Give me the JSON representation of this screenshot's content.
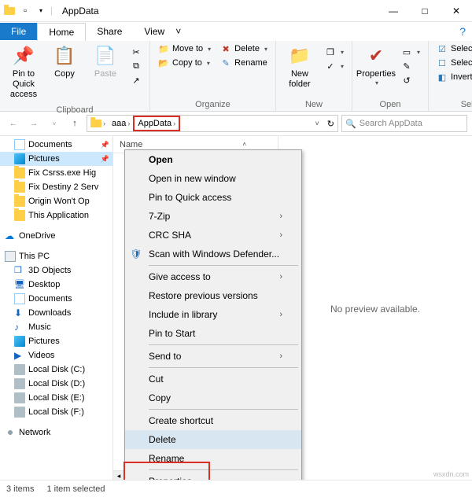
{
  "titlebar": {
    "title": "AppData"
  },
  "window": {
    "minimize": "—",
    "maximize": "□",
    "close": "✕"
  },
  "tabs": {
    "file": "File",
    "home": "Home",
    "share": "Share",
    "view": "View"
  },
  "ribbon": {
    "clipboard": {
      "pin": "Pin to Quick access",
      "copy": "Copy",
      "paste": "Paste",
      "label": "Clipboard"
    },
    "organize": {
      "moveto": "Move to",
      "copyto": "Copy to",
      "delete": "Delete",
      "rename": "Rename",
      "label": "Organize"
    },
    "new": {
      "newfolder": "New folder",
      "label": "New"
    },
    "open": {
      "properties": "Properties",
      "label": "Open"
    },
    "select": {
      "selectall": "Select all",
      "selectnone": "Select none",
      "invert": "Invert selection",
      "label": "Select"
    }
  },
  "address": {
    "seg1": "aaa",
    "seg2": "AppData",
    "refresh": "↻"
  },
  "search": {
    "placeholder": "Search AppData"
  },
  "nav": {
    "documents": "Documents",
    "pictures": "Pictures",
    "fix_csrss": "Fix Csrss.exe Hig",
    "fix_destiny": "Fix Destiny 2 Serv",
    "origin": "Origin Won't Op",
    "thisapp": "This Application",
    "onedrive": "OneDrive",
    "thispc": "This PC",
    "objects3d": "3D Objects",
    "desktop": "Desktop",
    "documents2": "Documents",
    "downloads": "Downloads",
    "music": "Music",
    "pictures2": "Pictures",
    "videos": "Videos",
    "cdrive": "Local Disk (C:)",
    "ddrive": "Local Disk (D:)",
    "edrive": "Local Disk (E:)",
    "fdrive": "Local Disk (F:)",
    "network": "Network"
  },
  "list": {
    "header_name": "Name"
  },
  "preview": {
    "msg": "No preview available."
  },
  "context": {
    "open": "Open",
    "open_new": "Open in new window",
    "pin_qa": "Pin to Quick access",
    "sevenzip": "7-Zip",
    "crcsha": "CRC SHA",
    "defender": "Scan with Windows Defender...",
    "giveaccess": "Give access to",
    "restore": "Restore previous versions",
    "include": "Include in library",
    "pinstart": "Pin to Start",
    "sendto": "Send to",
    "cut": "Cut",
    "copy": "Copy",
    "shortcut": "Create shortcut",
    "delete": "Delete",
    "rename": "Rename",
    "properties": "Properties"
  },
  "status": {
    "items": "3 items",
    "selected": "1 item selected"
  },
  "watermark": "wsxdn.com"
}
